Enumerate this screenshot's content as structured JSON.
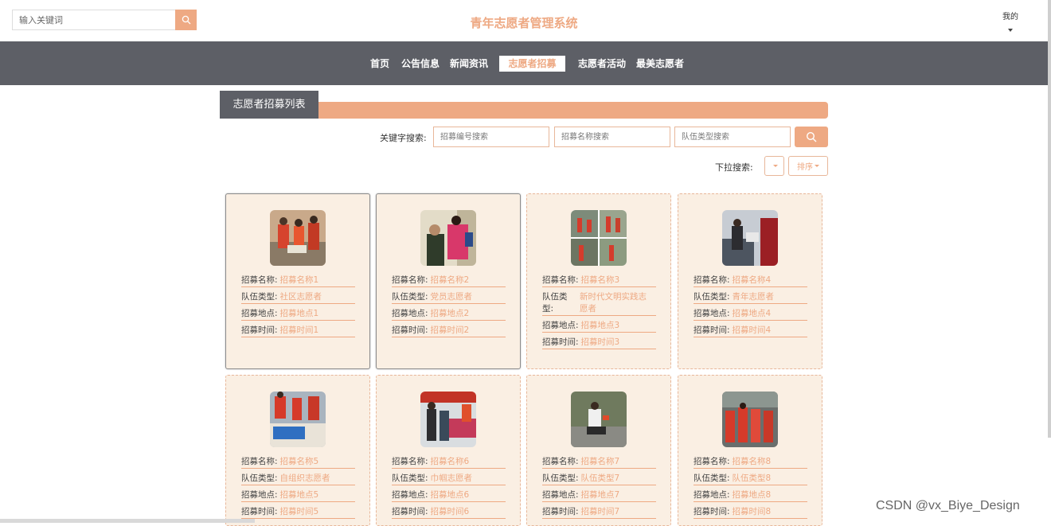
{
  "header": {
    "search_placeholder": "输入关键词",
    "site_title": "青年志愿者管理系统",
    "user_menu": "我的"
  },
  "nav": {
    "items": [
      {
        "label": "首页"
      },
      {
        "label": "公告信息"
      },
      {
        "label": "新闻资讯"
      },
      {
        "label": "志愿者招募",
        "active": true
      },
      {
        "label": "志愿者活动"
      },
      {
        "label": "最美志愿者"
      }
    ]
  },
  "section": {
    "title": "志愿者招募列表"
  },
  "filters": {
    "keyword_label": "关键字搜索:",
    "placeholders": [
      "招募编号搜索",
      "招募名称搜索",
      "队伍类型搜索"
    ],
    "dropdown_label": "下拉搜索:",
    "sort_label": "排序"
  },
  "field_labels": {
    "name": "招募名称:",
    "type": "队伍类型:",
    "location": "招募地点:",
    "time": "招募时间:"
  },
  "cards": [
    {
      "name": "招募名称1",
      "type": "社区志愿者",
      "location": "招募地点1",
      "time": "招募时间1"
    },
    {
      "name": "招募名称2",
      "type": "党员志愿者",
      "location": "招募地点2",
      "time": "招募时间2"
    },
    {
      "name": "招募名称3",
      "type": "新时代文明实践志愿者",
      "location": "招募地点3",
      "time": "招募时间3"
    },
    {
      "name": "招募名称4",
      "type": "青年志愿者",
      "location": "招募地点4",
      "time": "招募时间4"
    },
    {
      "name": "招募名称5",
      "type": "自组织志愿者",
      "location": "招募地点5",
      "time": "招募时间5"
    },
    {
      "name": "招募名称6",
      "type": "巾帼志愿者",
      "location": "招募地点6",
      "time": "招募时间6"
    },
    {
      "name": "招募名称7",
      "type": "队伍类型7",
      "location": "招募地点7",
      "time": "招募时间7"
    },
    {
      "name": "招募名称8",
      "type": "队伍类型8",
      "location": "招募地点8",
      "time": "招募时间8"
    }
  ],
  "watermark": "CSDN @vx_Biye_Design",
  "colors": {
    "accent": "#eea983",
    "nav_bg": "#5d5f66",
    "card_bg": "#faefe3"
  }
}
